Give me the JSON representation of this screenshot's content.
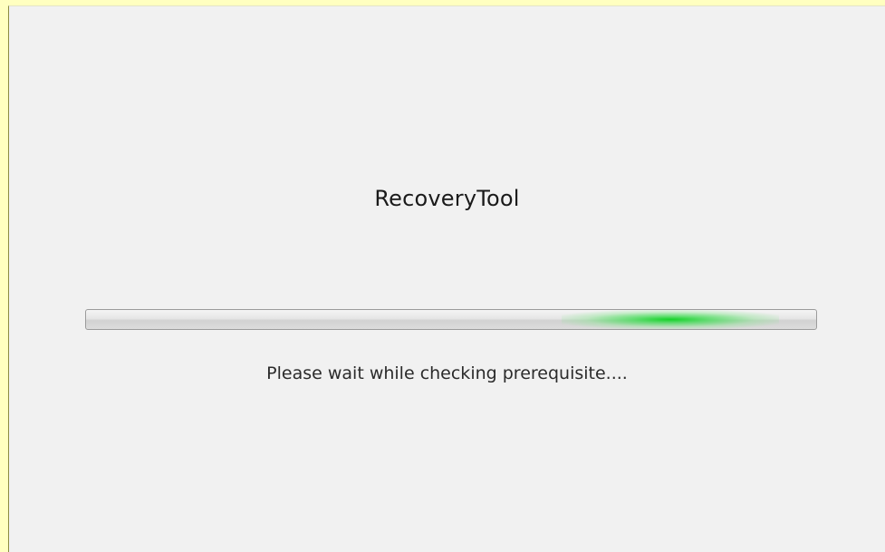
{
  "window": {
    "title": "RecoveryTool",
    "status": "Please wait while checking prerequisite...."
  },
  "progress": {
    "mode": "indeterminate",
    "marquee_center_fraction": 0.8,
    "fill_color": "#12d22a"
  },
  "colors": {
    "background": "#f1f1f1",
    "outer_border": "#ffffc0"
  }
}
